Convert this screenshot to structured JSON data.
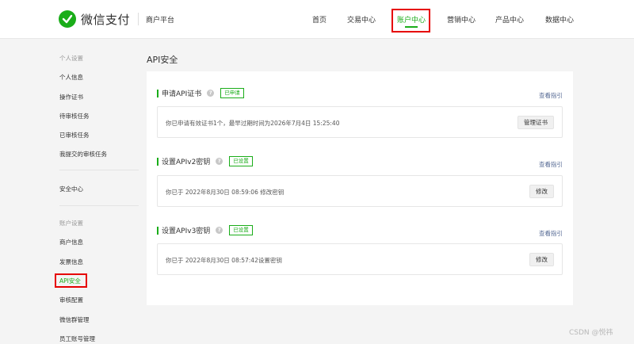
{
  "header": {
    "brand": "微信支付",
    "platform": "商户平台",
    "nav": [
      "首页",
      "交易中心",
      "账户中心",
      "营销中心",
      "产品中心",
      "数据中心"
    ],
    "active_nav": "账户中心"
  },
  "sidebar": {
    "group_personal": "个人设置",
    "personal_items": [
      "个人信息",
      "操作证书",
      "待审核任务",
      "已审核任务",
      "我提交的审核任务"
    ],
    "security": "安全中心",
    "group_account": "账户设置",
    "account_items": [
      "商户信息",
      "发票信息",
      "API安全",
      "审核配置",
      "微信群管理",
      "员工账号管理"
    ],
    "active_item": "API安全"
  },
  "main": {
    "title": "API安全",
    "sections": [
      {
        "title": "申请API证书",
        "badge": "已申请",
        "guide": "查看指引",
        "info": "你已申请有效证书1个，最早过期时间为2026年7月4日 15:25:40",
        "button": "管理证书"
      },
      {
        "title": "设置APIv2密钥",
        "badge": "已设置",
        "guide": "查看指引",
        "info": "你已于 2022年8月30日 08:59:06 修改密钥",
        "button": "修改"
      },
      {
        "title": "设置APIv3密钥",
        "badge": "已设置",
        "guide": "查看指引",
        "info": "你已于 2022年8月30日 08:57:42设置密钥",
        "button": "修改"
      }
    ]
  },
  "watermark": "CSDN @悦祎",
  "colors": {
    "brand_green": "#1aad19",
    "highlight_red": "#e60000",
    "link_blue": "#576b95"
  }
}
